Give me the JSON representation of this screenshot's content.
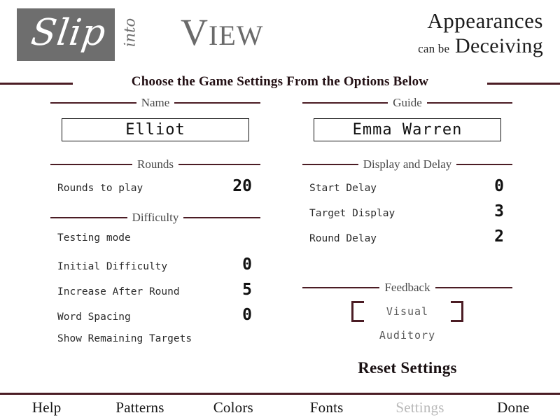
{
  "header": {
    "logo": {
      "script_word": "Slip",
      "vertical_word": "into",
      "block_color": "#6e6e6e"
    },
    "wordmark_cap": "V",
    "wordmark_rest": "IEW",
    "tagline_line1": "Appearances",
    "tagline_small": "can be",
    "tagline_line2": "Deceiving"
  },
  "page_title": "Choose the Game Settings From the Options Below",
  "accent_color": "#4b1c24",
  "left_column": {
    "name_section": {
      "legend": "Name",
      "value": "Elliot",
      "placeholder": "Name"
    },
    "rounds_section": {
      "legend": "Rounds",
      "rows": [
        {
          "label": "Rounds to play",
          "value": "20"
        }
      ]
    },
    "difficulty_section": {
      "legend": "Difficulty",
      "rows": [
        {
          "label": "Testing mode",
          "value": ""
        },
        {
          "label": "Initial Difficulty",
          "value": "0"
        },
        {
          "label": "Increase After Round",
          "value": "5"
        },
        {
          "label": "Word Spacing",
          "value": "0"
        },
        {
          "label": "Show Remaining Targets",
          "value": ""
        }
      ]
    }
  },
  "right_column": {
    "guide_section": {
      "legend": "Guide",
      "value": "Emma Warren",
      "placeholder": "Guide"
    },
    "display_delay_section": {
      "legend": "Display and Delay",
      "rows": [
        {
          "label": "Start Delay",
          "value": "0"
        },
        {
          "label": "Target Display",
          "value": "3"
        },
        {
          "label": "Round Delay",
          "value": "2"
        }
      ]
    },
    "feedback_section": {
      "legend": "Feedback",
      "options": [
        {
          "label": "Visual",
          "selected": true
        },
        {
          "label": "Auditory",
          "selected": false
        }
      ]
    },
    "reset_label": "Reset Settings"
  },
  "nav": {
    "items": [
      {
        "label": "Help",
        "current": false
      },
      {
        "label": "Patterns",
        "current": false
      },
      {
        "label": "Colors",
        "current": false
      },
      {
        "label": "Fonts",
        "current": false
      },
      {
        "label": "Settings",
        "current": true
      },
      {
        "label": "Done",
        "current": false
      }
    ]
  }
}
